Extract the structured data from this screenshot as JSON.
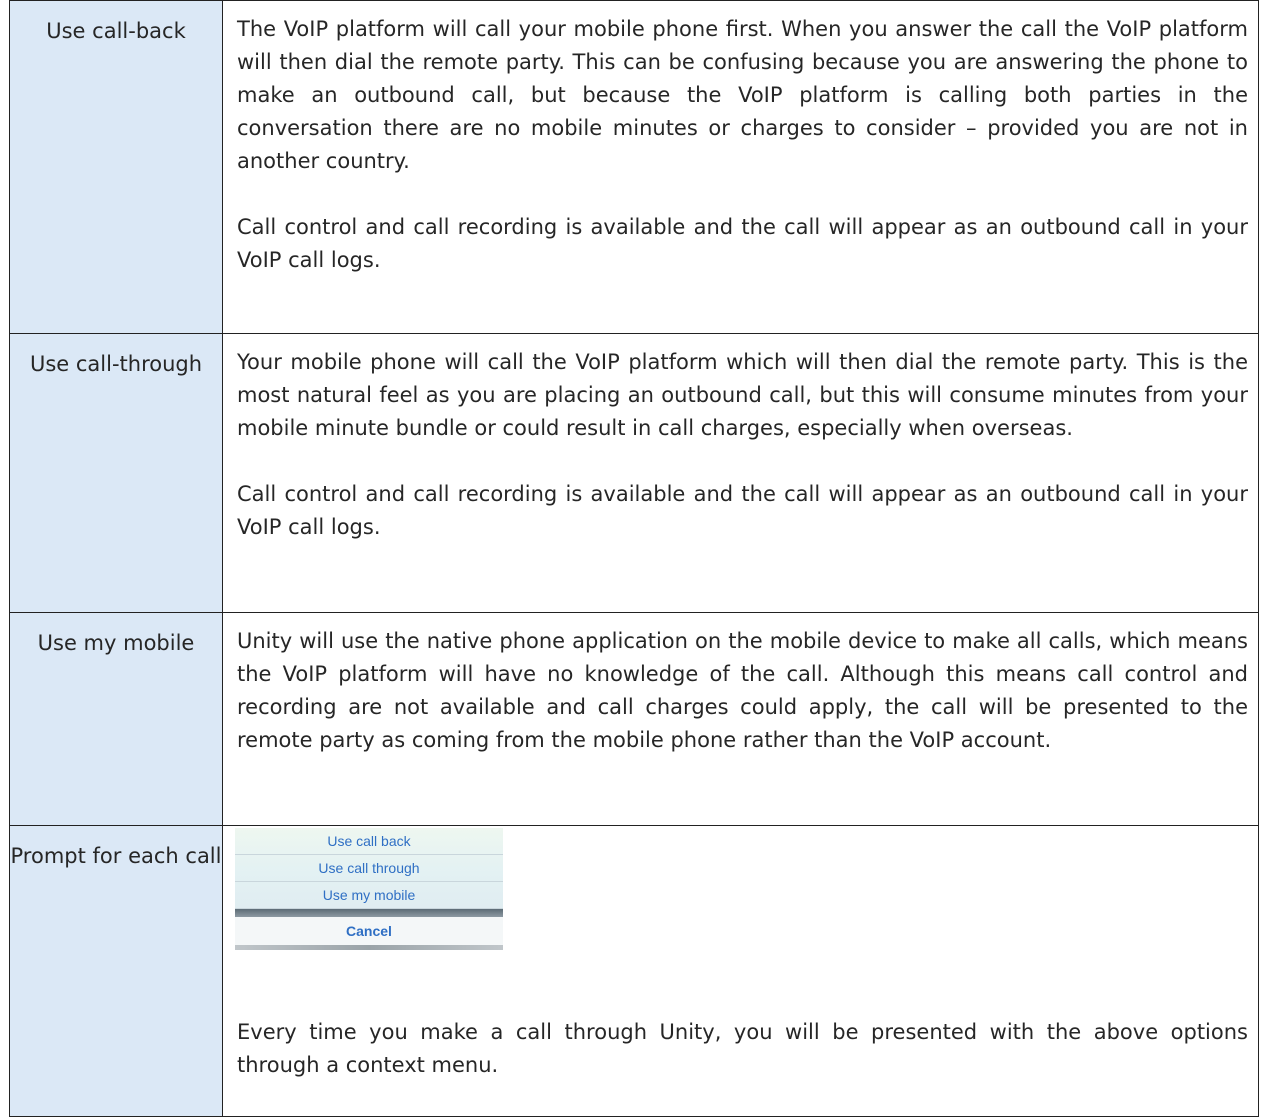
{
  "rows": [
    {
      "label": "Use call-back",
      "paragraphs": [
        "The VoIP platform will call your mobile phone first. When you answer the call the VoIP platform will then dial the remote party. This can be confusing because you are answering the phone to make an outbound call, but because the VoIP platform is calling both parties in the conversation there are no mobile minutes or charges to consider – provided you are not in another country.",
        "Call control and call recording is available and the call will appear as an outbound call in your VoIP call logs."
      ]
    },
    {
      "label": "Use call-through",
      "paragraphs": [
        "Your mobile phone will call the VoIP platform which will then dial the remote party. This is the most natural feel as you are placing an outbound call, but this will consume minutes from your mobile minute bundle or could result in call charges, especially when overseas.",
        "Call control and call recording is available and the call will appear as an outbound call in your VoIP call logs."
      ]
    },
    {
      "label": "Use my mobile",
      "paragraphs": [
        "Unity will use the native phone application on the mobile device to make all calls, which means the VoIP platform will have no knowledge of the call. Although this means call control and recording are not available and call charges could apply, the call will be presented to the remote party as coming from the mobile phone rather than the VoIP account."
      ]
    },
    {
      "label": "Prompt for each call",
      "menu_items": [
        "Use call back",
        "Use call through",
        "Use my mobile"
      ],
      "menu_cancel": "Cancel",
      "paragraphs": [
        "Every time you make a call through Unity, you will be presented with the above options through a context menu."
      ]
    }
  ]
}
